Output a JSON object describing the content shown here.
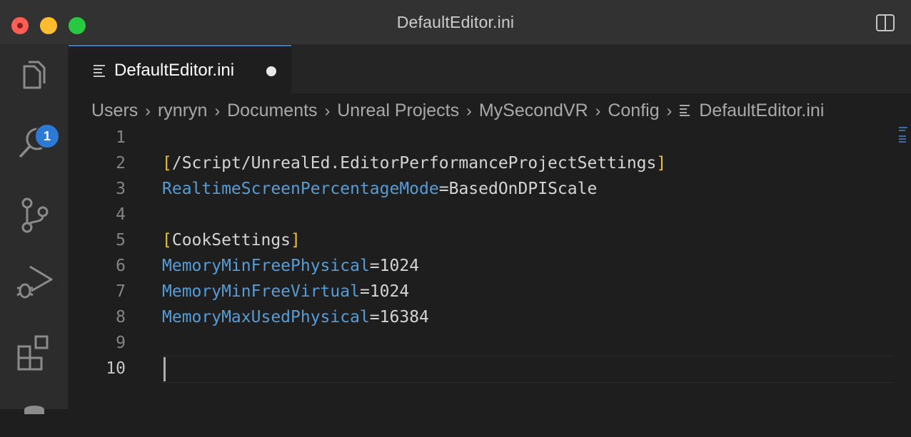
{
  "window": {
    "title": "DefaultEditor.ini"
  },
  "activity_bar": {
    "explorer_badge": "1"
  },
  "tab": {
    "label": "DefaultEditor.ini",
    "unsaved": true
  },
  "breadcrumb": [
    "Users",
    "rynryn",
    "Documents",
    "Unreal Projects",
    "MySecondVR",
    "Config",
    "DefaultEditor.ini"
  ],
  "editor": {
    "active_line": 10,
    "lines": [
      {
        "n": "1",
        "text": ""
      },
      {
        "n": "2",
        "open": "[",
        "section": "/Script/UnrealEd.EditorPerformanceProjectSettings",
        "close": "]"
      },
      {
        "n": "3",
        "key": "RealtimeScreenPercentageMode",
        "eq": "=",
        "value": "BasedOnDPIScale"
      },
      {
        "n": "4",
        "text": ""
      },
      {
        "n": "5",
        "open": "[",
        "section": "CookSettings",
        "close": "]"
      },
      {
        "n": "6",
        "key": "MemoryMinFreePhysical",
        "eq": "=",
        "value": "1024"
      },
      {
        "n": "7",
        "key": "MemoryMinFreeVirtual",
        "eq": "=",
        "value": "1024"
      },
      {
        "n": "8",
        "key": "MemoryMaxUsedPhysical",
        "eq": "=",
        "value": "16384"
      },
      {
        "n": "9",
        "text": ""
      },
      {
        "n": "10",
        "text": ""
      }
    ]
  },
  "colors": {
    "accent": "#3b78c6",
    "key": "#569cd6",
    "bracket": "#e8c23a",
    "badge": "#2d7ad6"
  }
}
